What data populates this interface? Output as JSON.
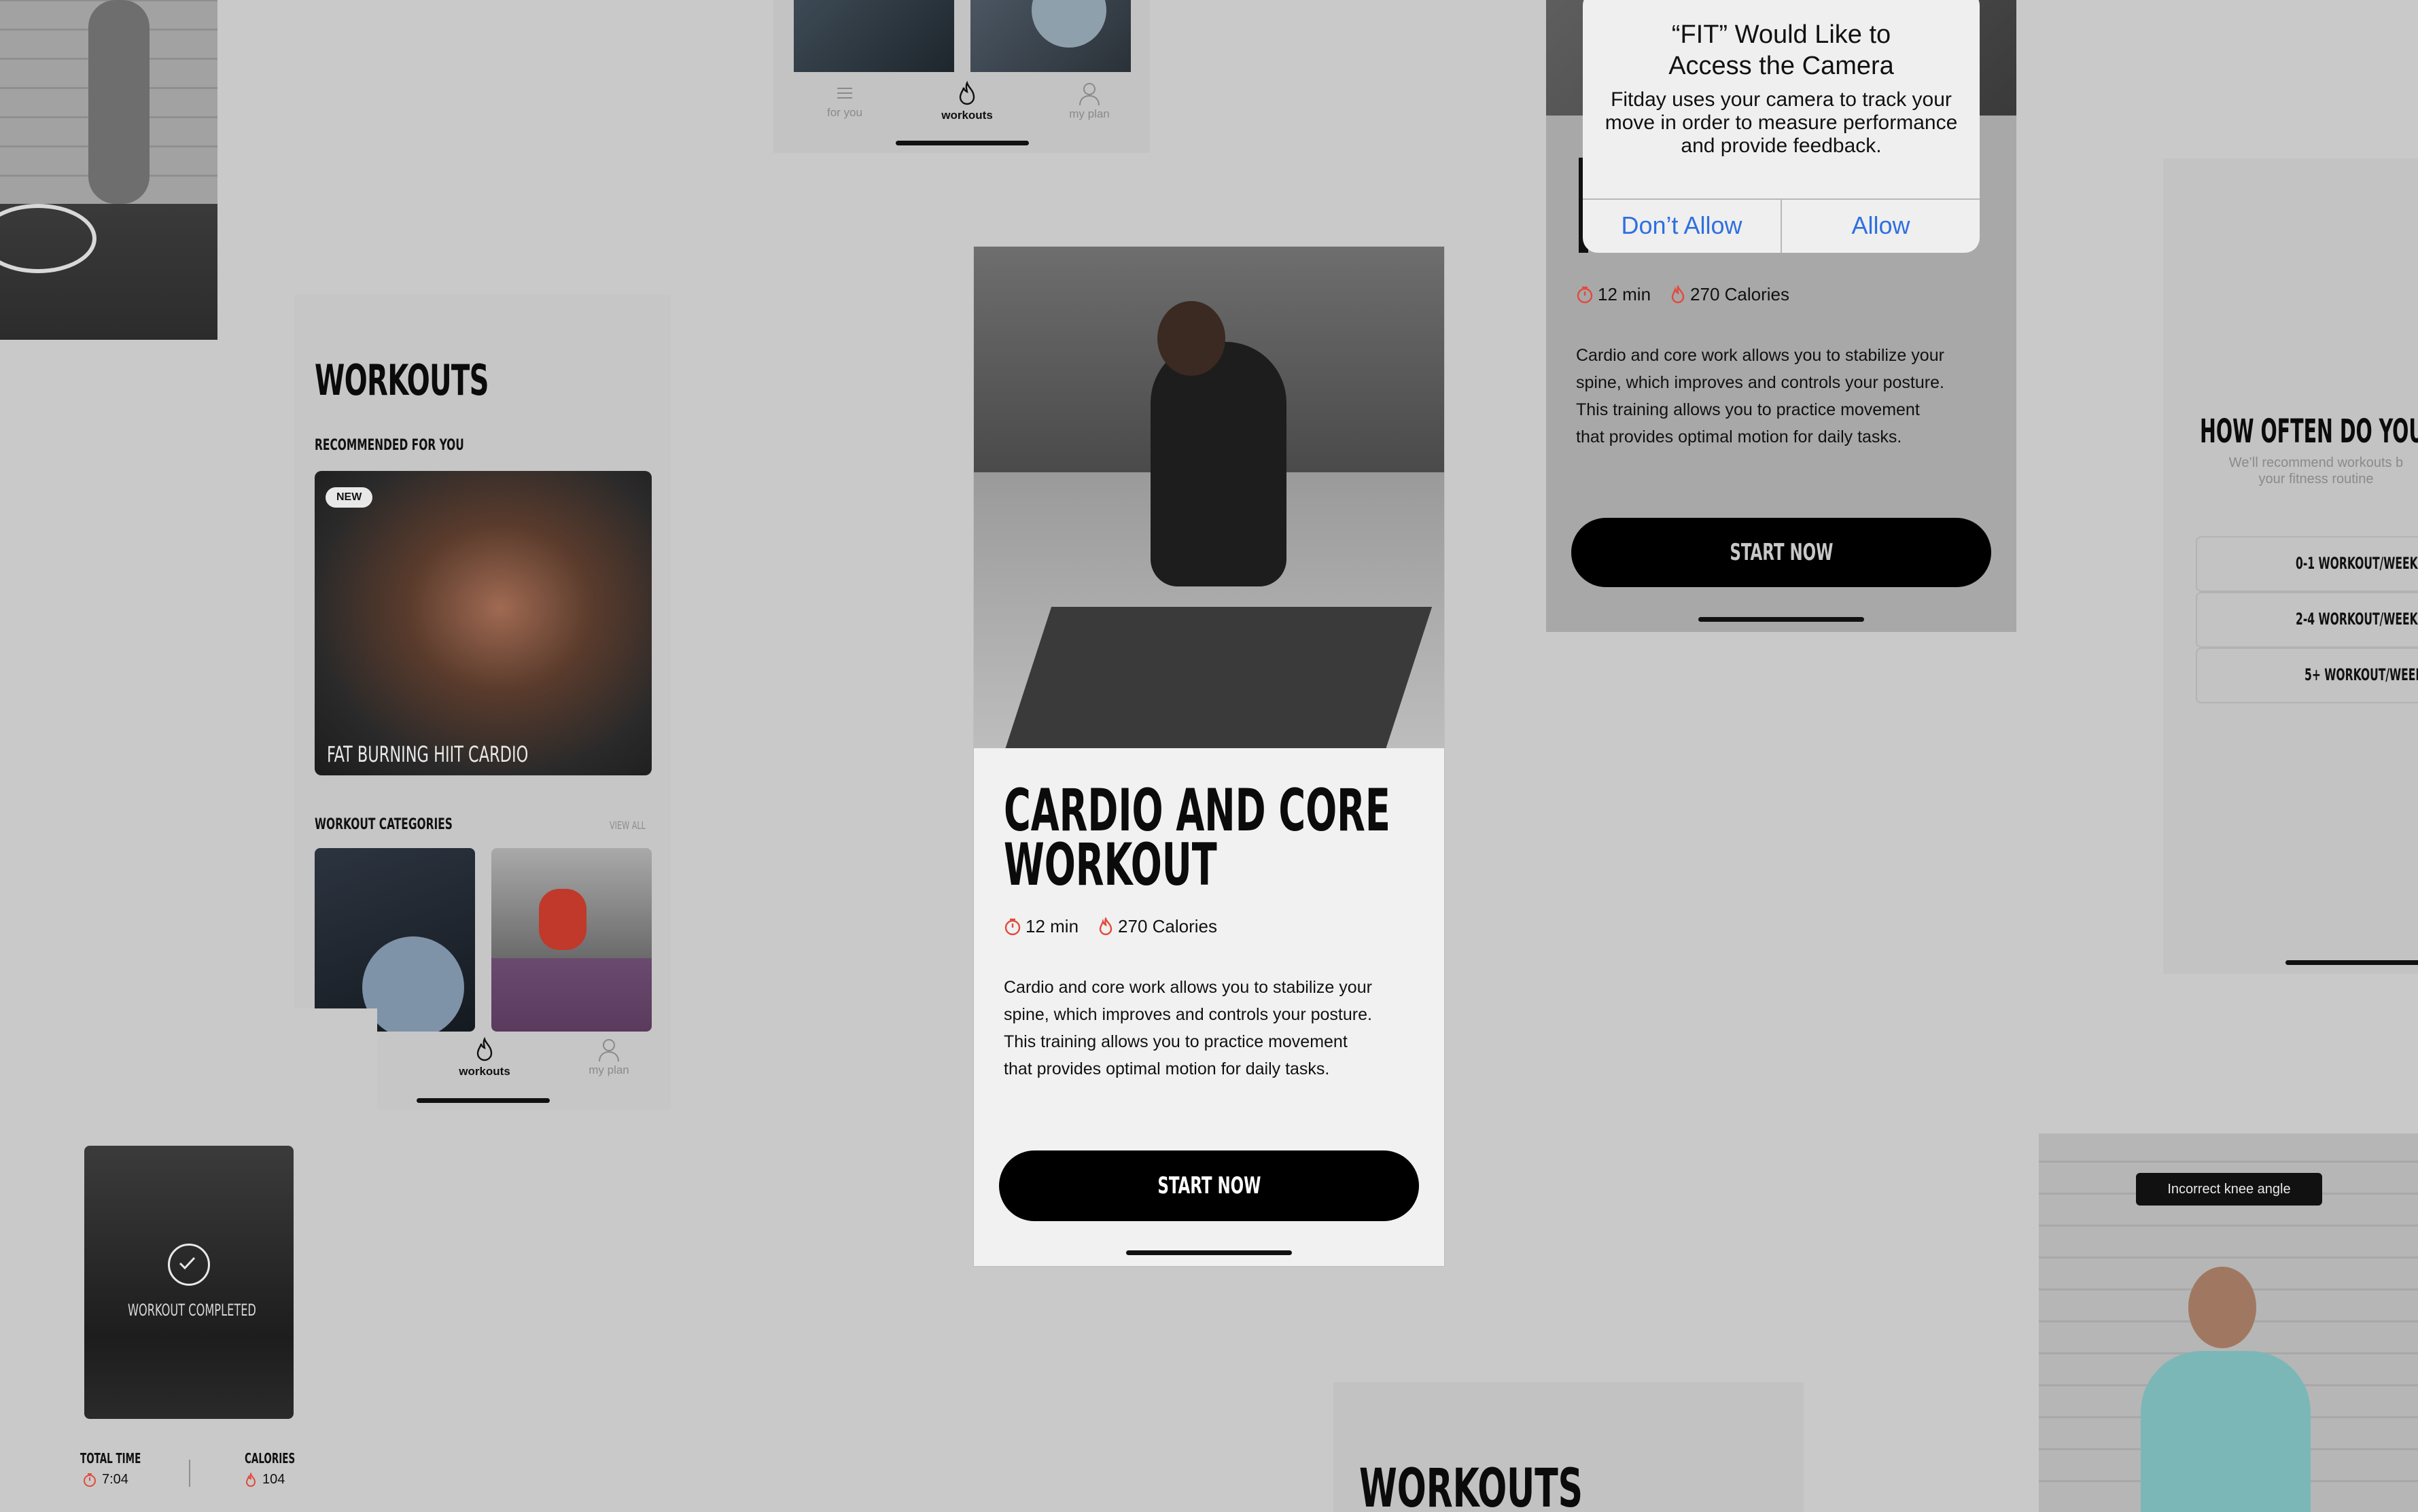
{
  "nav": {
    "for_you": "for you",
    "workouts": "workouts",
    "my_plan": "my plan"
  },
  "workouts_screen": {
    "title": "WORKOUTS",
    "recommended_heading": "RECOMMENDED FOR YOU",
    "new_badge": "NEW",
    "featured_title": "FAT BURNING HIIT CARDIO",
    "categories_heading": "WORKOUT CATEGORIES",
    "view_all": "VIEW ALL"
  },
  "detail": {
    "title_line1": "CARDIO AND CORE",
    "title_line2": "WORKOUT",
    "duration": "12 min",
    "calories": "270 Calories",
    "description_lines": [
      "Cardio and core work allows you to stabilize your",
      "spine, which improves and controls your posture.",
      "This training allows you to practice movement",
      "that provides optimal motion for daily tasks."
    ],
    "start_label": "START NOW"
  },
  "camera_dialog": {
    "title_line1": "“FIT” Would Like to",
    "title_line2": "Access the Camera",
    "message_line1": "Fitday uses your camera to track your",
    "message_line2": "move in order to measure performance",
    "message_line3": "and provide feedback.",
    "deny": "Don’t Allow",
    "allow": "Allow"
  },
  "background_detail": {
    "duration": "12 min",
    "calories": "270 Calories",
    "description_lines": [
      "Cardio and core work allows you to stabilize your",
      "spine, which improves and controls your posture.",
      "This training allows you to practice movement",
      "that provides optimal motion for daily tasks."
    ],
    "start_label": "START NOW"
  },
  "frequency": {
    "title": "HOW OFTEN DO YOU WO",
    "subtitle_line1": "We’ll recommend workouts b",
    "subtitle_line2": "your fitness routine",
    "options": [
      "0-1 WORKOUT/WEEK",
      "2-4 WORKOUT/WEEK",
      "5+ WORKOUT/WEEK"
    ]
  },
  "completed": {
    "label": "WORKOUT COMPLETED",
    "total_time_label": "TOTAL TIME",
    "total_time_value": "7:04",
    "calories_label": "CALORIES",
    "calories_value": "104"
  },
  "pose": {
    "warning": "Incorrect knee angle"
  },
  "bottom_workouts": {
    "title": "WORKOUTS"
  },
  "colors": {
    "accent_red": "#e24a3b",
    "dialog_blue": "#2f6fe0",
    "button_black": "#000000"
  }
}
